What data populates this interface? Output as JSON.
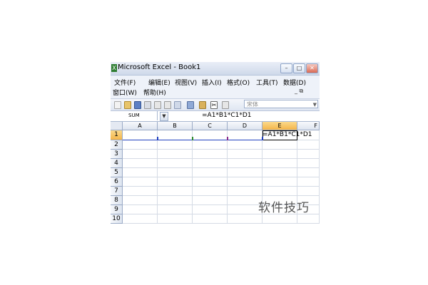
{
  "window": {
    "title": "Microsoft Excel - Book1"
  },
  "menu": {
    "row1": [
      {
        "label": "文件(F)"
      },
      {
        "label": "编辑(E)"
      },
      {
        "label": "视图(V)"
      },
      {
        "label": "插入(I)"
      },
      {
        "label": "格式(O)"
      },
      {
        "label": "工具(T)"
      },
      {
        "label": "数据(D)"
      }
    ],
    "row2": [
      {
        "label": "窗口(W)"
      },
      {
        "label": "帮助(H)"
      }
    ]
  },
  "toolbar": {
    "font_name": "宋体"
  },
  "formula_bar": {
    "name_box": "SUM",
    "formula": "=A1*B1*C1*D1"
  },
  "grid": {
    "columns": [
      "A",
      "B",
      "C",
      "D",
      "E",
      "F"
    ],
    "rows": [
      "1",
      "2",
      "3",
      "4",
      "5",
      "6",
      "7",
      "8",
      "9",
      "10"
    ],
    "active_cell": "E1",
    "active_cell_text": "=A1*B1*C1*D1",
    "reference_colors": [
      "#1f3fbf",
      "#2e8b2e",
      "#8b2a8b",
      "#1f3fbf"
    ]
  },
  "watermark": "软件技巧"
}
